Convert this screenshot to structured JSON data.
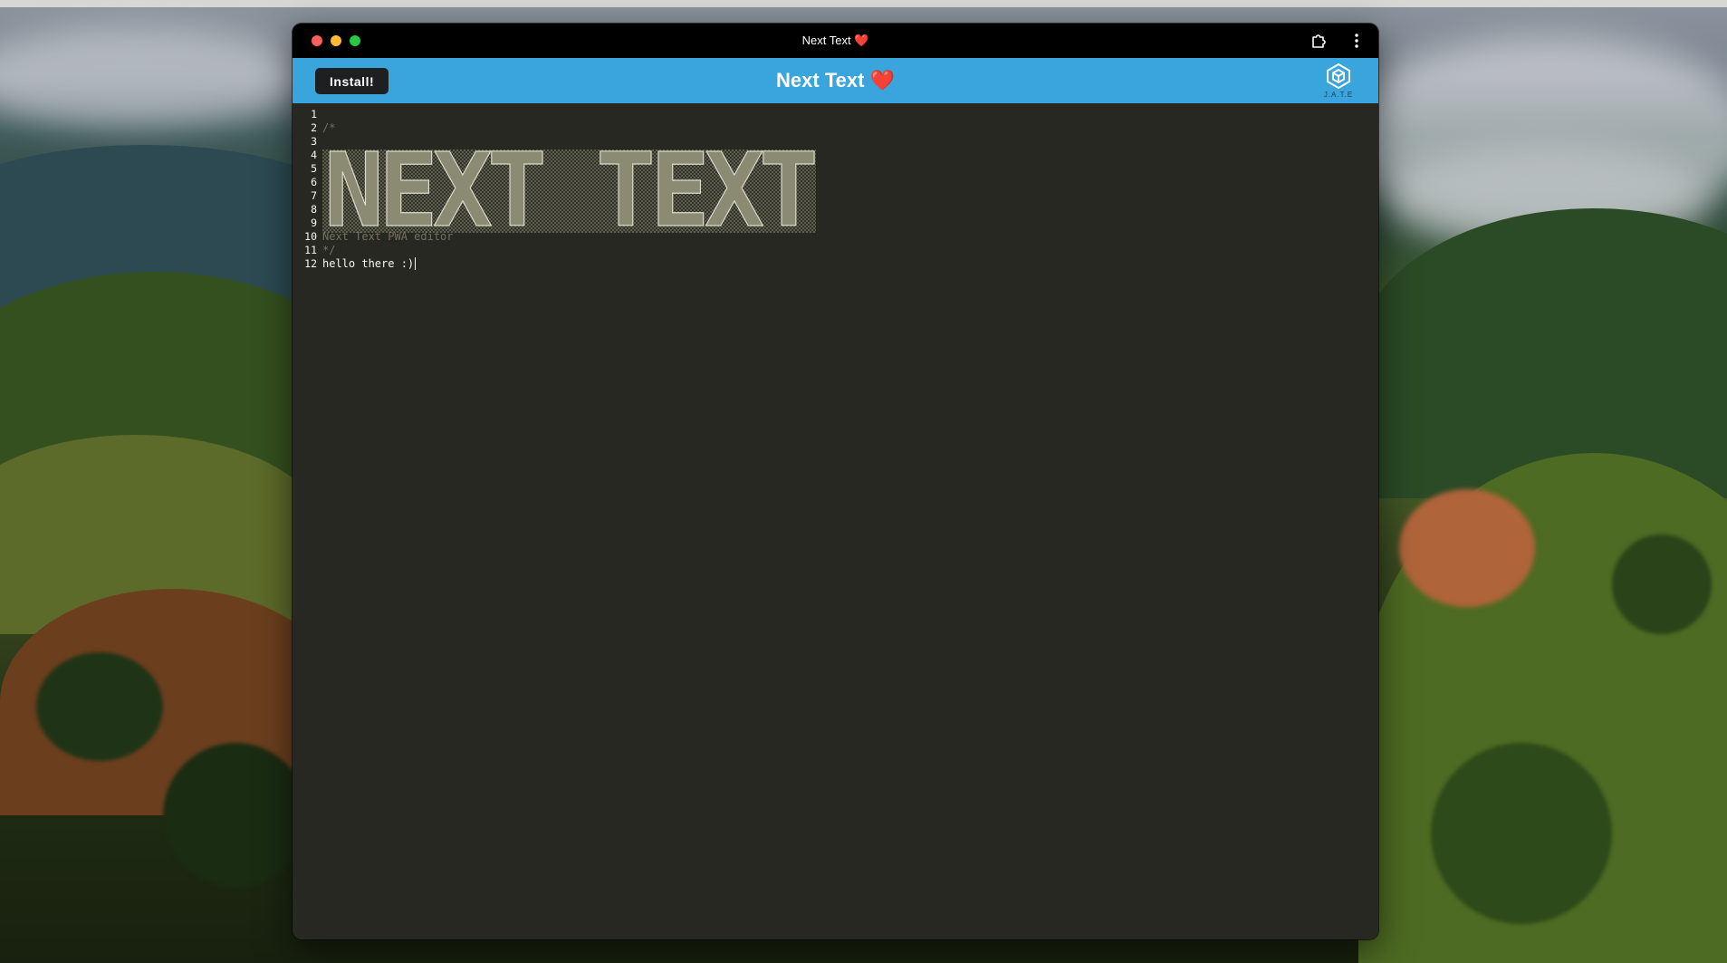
{
  "window": {
    "title": "Next Text ❤️"
  },
  "header": {
    "install_label": "Install!",
    "app_title": "Next Text ❤️",
    "logo_caption": "J.A.T.E"
  },
  "editor": {
    "lines": [
      {
        "num": "1",
        "text": ""
      },
      {
        "num": "2",
        "text": "/*"
      },
      {
        "num": "3",
        "text": ""
      },
      {
        "num": "4",
        "text": ""
      },
      {
        "num": "5",
        "text": ""
      },
      {
        "num": "6",
        "text": ""
      },
      {
        "num": "7",
        "text": ""
      },
      {
        "num": "8",
        "text": ""
      },
      {
        "num": "9",
        "text": ""
      },
      {
        "num": "10",
        "text": "Next Text PWA editor"
      },
      {
        "num": "11",
        "text": "*/"
      },
      {
        "num": "12",
        "text": "hello there :)"
      }
    ],
    "banner_text": "NEXT TEXT"
  },
  "icons": {
    "extension": "puzzle-icon",
    "menu": "kebab-menu-icon",
    "logo": "hexagon-cube-logo-icon"
  },
  "colors": {
    "navbar": "#3aa5dc",
    "editor_bg": "#272822",
    "comment": "#75715e",
    "banner": "#8b8a72"
  }
}
